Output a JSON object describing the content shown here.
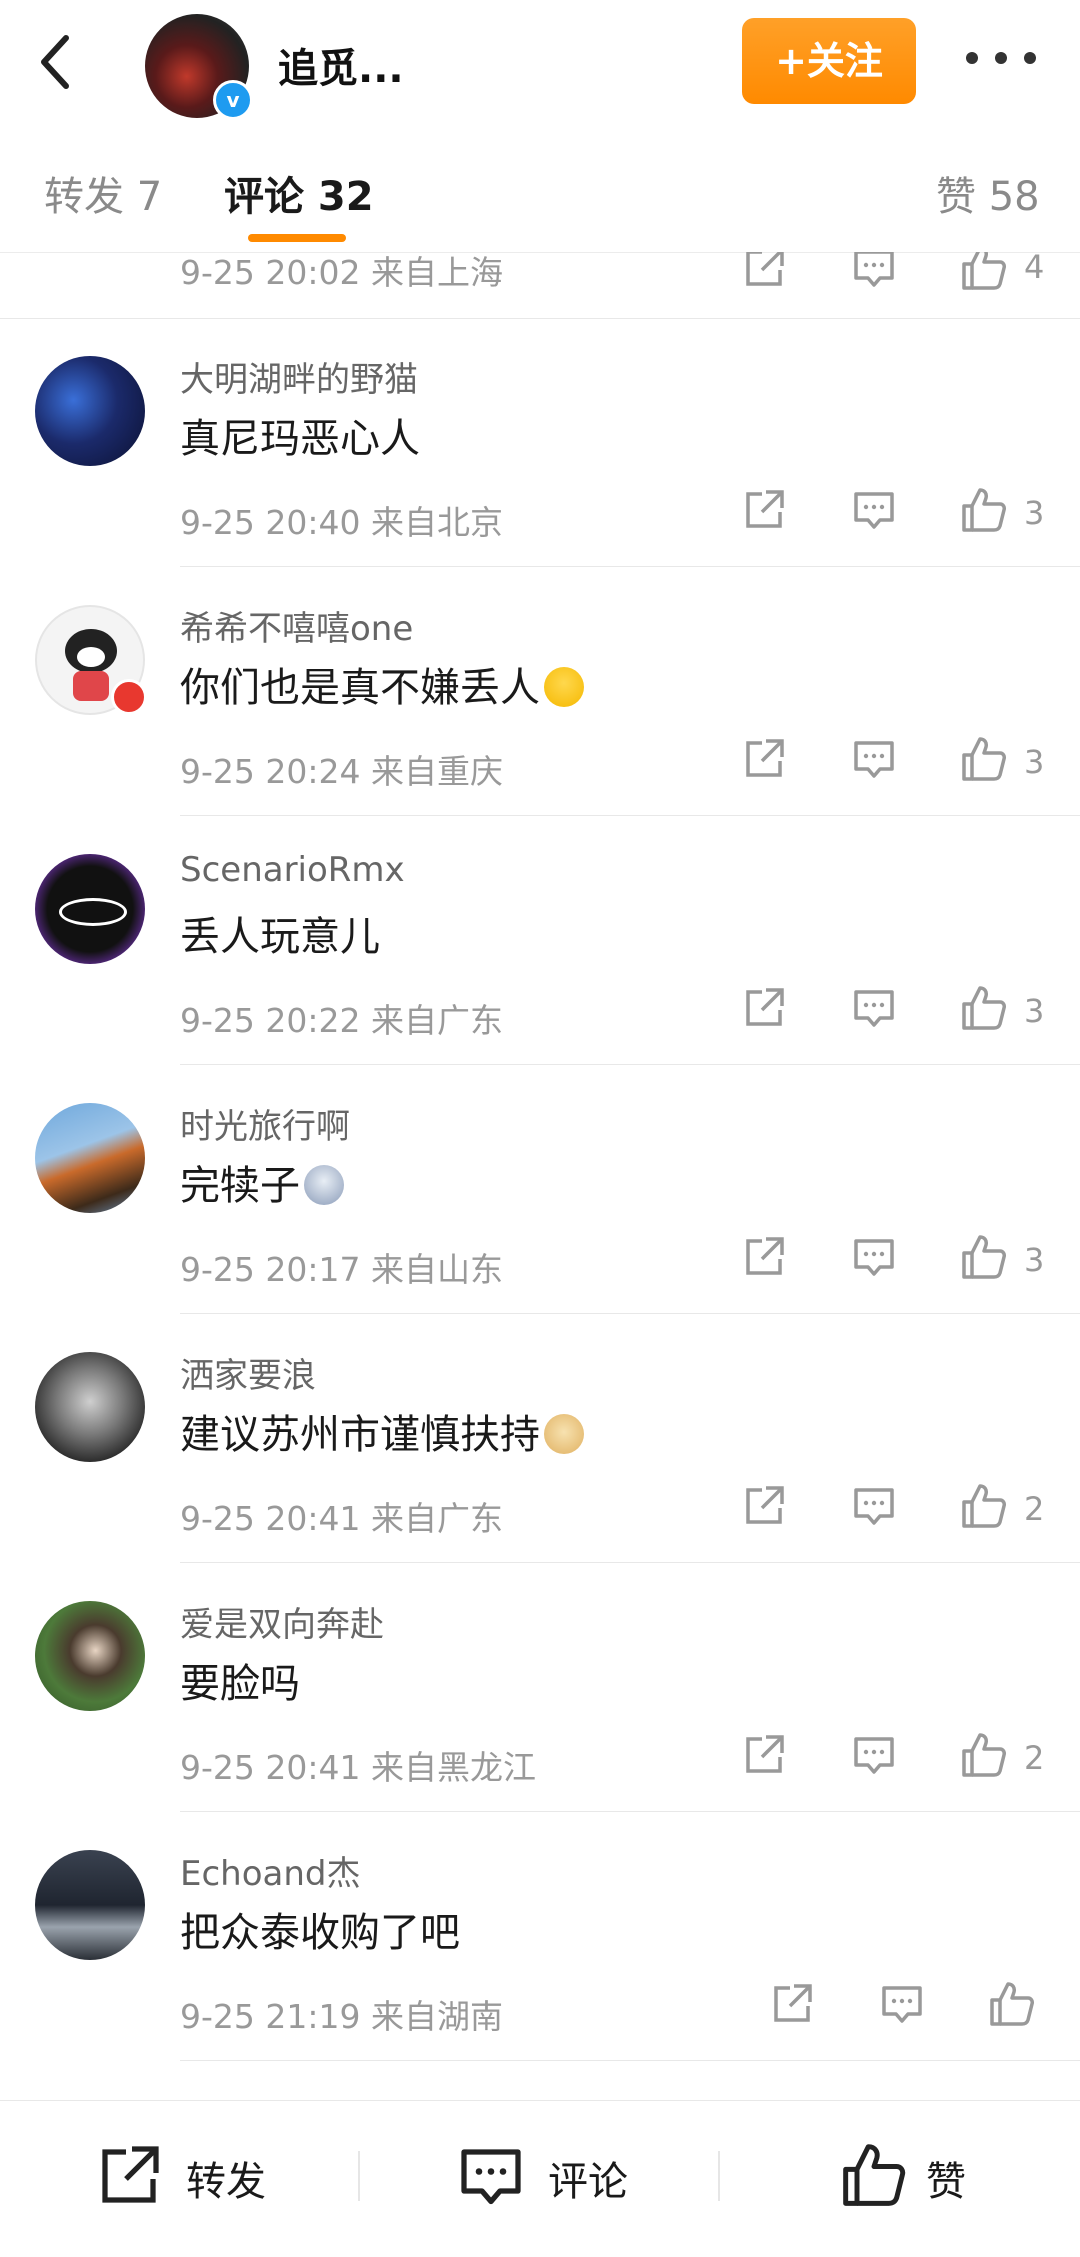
{
  "header": {
    "title": "追觅...",
    "follow_label": "+关注"
  },
  "tabs": {
    "repost": "转发 7",
    "comment": "评论 32",
    "like": "赞 58"
  },
  "partial_comment": {
    "meta": "9-25 20:02  来自上海",
    "likes": "4"
  },
  "comments": [
    {
      "name": "大明湖畔的野猫",
      "text": "真尼玛恶心人",
      "meta": "9-25 20:40  来自北京",
      "likes": "3"
    },
    {
      "name": "希希不嘻嘻one",
      "text": "你们也是真不嫌丢人",
      "meta": "9-25 20:24  来自重庆",
      "likes": "3"
    },
    {
      "name": "ScenarioRmx",
      "text": "丢人玩意儿",
      "meta": "9-25 20:22  来自广东",
      "likes": "3"
    },
    {
      "name": "时光旅行啊",
      "text": "完犊子",
      "meta": "9-25 20:17  来自山东",
      "likes": "3"
    },
    {
      "name": "洒家要浪",
      "text": "建议苏州市谨慎扶持",
      "meta": "9-25 20:41  来自广东",
      "likes": "2"
    },
    {
      "name": "爱是双向奔赴",
      "text": "要脸吗",
      "meta": "9-25 20:41  来自黑龙江",
      "likes": "2"
    },
    {
      "name": "Echoand杰",
      "text": "把众泰收购了吧",
      "meta": "9-25 21:19  来自湖南",
      "likes": ""
    }
  ],
  "bottom_bar": {
    "repost": "转发",
    "comment": "评论",
    "like": "赞"
  },
  "colors": {
    "accent": "#ff8a00",
    "verified": "#1e9bf0"
  }
}
